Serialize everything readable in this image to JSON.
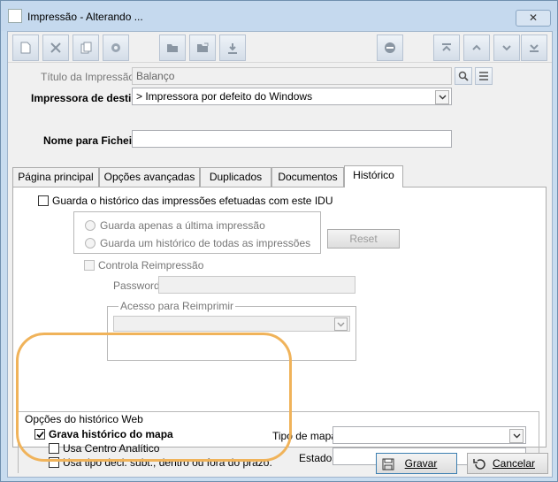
{
  "window": {
    "title": "Impressão - Alterando ...",
    "close_label": "✕"
  },
  "toolbar": {
    "buttons": [
      "new-icon",
      "delete-icon",
      "copy-icon",
      "gear-icon",
      "folder-icon",
      "folder-open-icon",
      "download-icon",
      "stop-icon",
      "first-icon",
      "up-icon",
      "down-icon",
      "last-icon"
    ]
  },
  "form": {
    "titulo_label": "Título da Impressão",
    "titulo_value": "Balanço",
    "impressora_label": "Impressora de destino",
    "impressora_value": "> Impressora por defeito do Windows",
    "ficheiro_label": "Nome para Ficheiro",
    "ficheiro_value": ""
  },
  "tabs": [
    {
      "label": "Página principal",
      "active": false
    },
    {
      "label": "Opções avançadas",
      "active": false
    },
    {
      "label": "Duplicados",
      "active": false
    },
    {
      "label": "Documentos",
      "active": false
    },
    {
      "label": "Histórico",
      "active": true
    }
  ],
  "historico": {
    "guarda_label": "Guarda o histórico das impressões efetuadas com este IDU",
    "guarda_checked": false,
    "radio_ultima": "Guarda apenas a última impressão",
    "radio_todas": "Guarda um histórico de todas as impressões",
    "reset_label": "Reset",
    "controla_label": "Controla Reimpressão",
    "password_label": "Password",
    "acesso_label": "Acesso para Reimprimir"
  },
  "web": {
    "group_label": "Opções do histórico Web",
    "grava_label": "Grava histórico do mapa",
    "grava_checked": true,
    "centro_label": "Usa Centro Analítico",
    "tipo_decl_label": "Usa tipo decl. subt., dentro ou fora do prazo.",
    "tipo_mapa_label": "Tipo de mapa",
    "estados_label": "Estados"
  },
  "footer": {
    "gravar_label": "Gravar",
    "cancelar_label": "Cancelar"
  },
  "colors": {
    "highlight": "#f0b35a",
    "titlebar": "#c5d9ee"
  }
}
